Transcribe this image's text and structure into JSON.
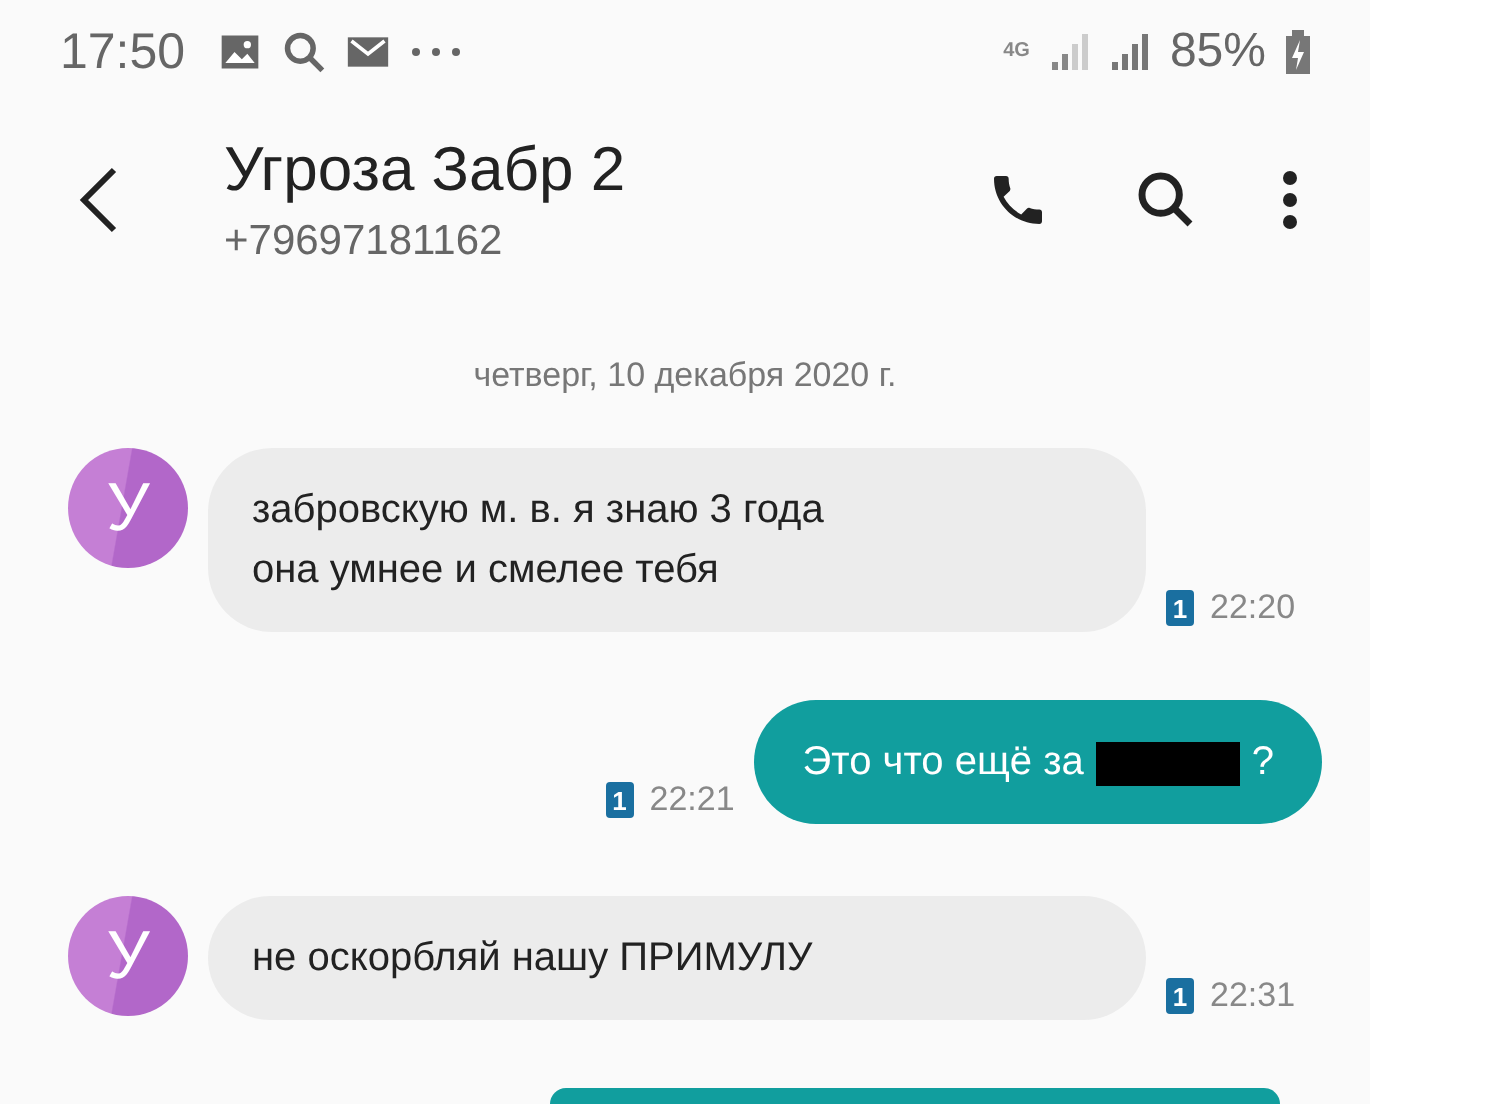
{
  "status_bar": {
    "time": "17:50",
    "network": "4G",
    "battery": "85%"
  },
  "header": {
    "title": "Угроза Забр 2",
    "number": "+79697181162"
  },
  "date_divider": "четверг, 10 декабря 2020 г.",
  "messages": [
    {
      "kind": "incoming",
      "avatar": "У",
      "lines": [
        "забровскую м. в. я знаю 3 года",
        "она умнее и смелее тебя"
      ],
      "sim": "1",
      "time": "22:20"
    },
    {
      "kind": "outgoing",
      "text_before": "Это что ещё за",
      "redacted": true,
      "text_after": "?",
      "sim": "1",
      "time": "22:21"
    },
    {
      "kind": "incoming",
      "avatar": "У",
      "lines": [
        "не оскорбляй нашу ПРИМУЛУ"
      ],
      "sim": "1",
      "time": "22:31"
    },
    {
      "kind": "outgoing_cut"
    }
  ]
}
